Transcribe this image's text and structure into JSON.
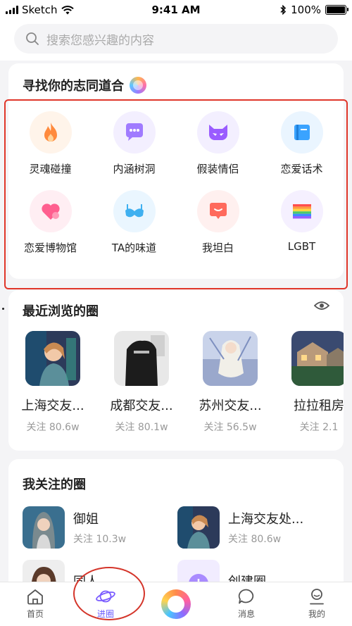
{
  "status_bar": {
    "carrier": "Sketch",
    "time": "9:41 AM",
    "battery": "100%"
  },
  "search": {
    "placeholder": "搜索您感兴趣的内容"
  },
  "discover": {
    "title": "寻找你的志同道合",
    "categories": [
      {
        "label": "灵魂碰撞",
        "icon": "flame-icon",
        "bg": "#fff4ea",
        "color": "#ff8a3d"
      },
      {
        "label": "内涵树洞",
        "icon": "chat-bubble-icon",
        "bg": "#f3efff",
        "color": "#a07bff"
      },
      {
        "label": "假装情侣",
        "icon": "cat-mask-icon",
        "bg": "#f3efff",
        "color": "#9a5cff"
      },
      {
        "label": "恋爱话术",
        "icon": "book-icon",
        "bg": "#eaf5ff",
        "color": "#3aa3ff"
      },
      {
        "label": "恋爱博物馆",
        "icon": "heart-icon",
        "bg": "#ffeef3",
        "color": "#ff5f8f"
      },
      {
        "label": "TA的味道",
        "icon": "bra-icon",
        "bg": "#eaf6ff",
        "color": "#3fb0f0"
      },
      {
        "label": "我坦白",
        "icon": "message-icon",
        "bg": "#fff0ef",
        "color": "#ff6a5c"
      },
      {
        "label": "LGBT",
        "icon": "rainbow-flag-icon",
        "bg": "#f5f0ff",
        "color": "#7c5cff"
      }
    ]
  },
  "recent": {
    "title": "最近浏览的圈",
    "items": [
      {
        "name": "上海交友...",
        "stat": "关注 80.6w",
        "thumb": "shanghai"
      },
      {
        "name": "成都交友...",
        "stat": "关注 80.1w",
        "thumb": "chengdu"
      },
      {
        "name": "苏州交友...",
        "stat": "关注 56.5w",
        "thumb": "suzhou"
      },
      {
        "name": "拉拉租房",
        "stat": "关注 2.1",
        "thumb": "rent"
      }
    ]
  },
  "following": {
    "title": "我关注的圈",
    "items": [
      {
        "name": "御姐",
        "stat": "关注 10.3w"
      },
      {
        "name": "上海交友处...",
        "stat": "关注 80.6w"
      },
      {
        "name": "同人",
        "stat": ""
      },
      {
        "name": "创建圈",
        "stat": ""
      }
    ]
  },
  "tabs": [
    {
      "label": "首页",
      "icon": "home-icon"
    },
    {
      "label": "进圈",
      "icon": "planet-icon"
    },
    {
      "label": "",
      "icon": "center-ring-icon"
    },
    {
      "label": "消息",
      "icon": "message-bubble-icon"
    },
    {
      "label": "我的",
      "icon": "profile-icon"
    }
  ],
  "colors": {
    "accent": "#6b5cff",
    "annotation_red": "#e0362a"
  }
}
